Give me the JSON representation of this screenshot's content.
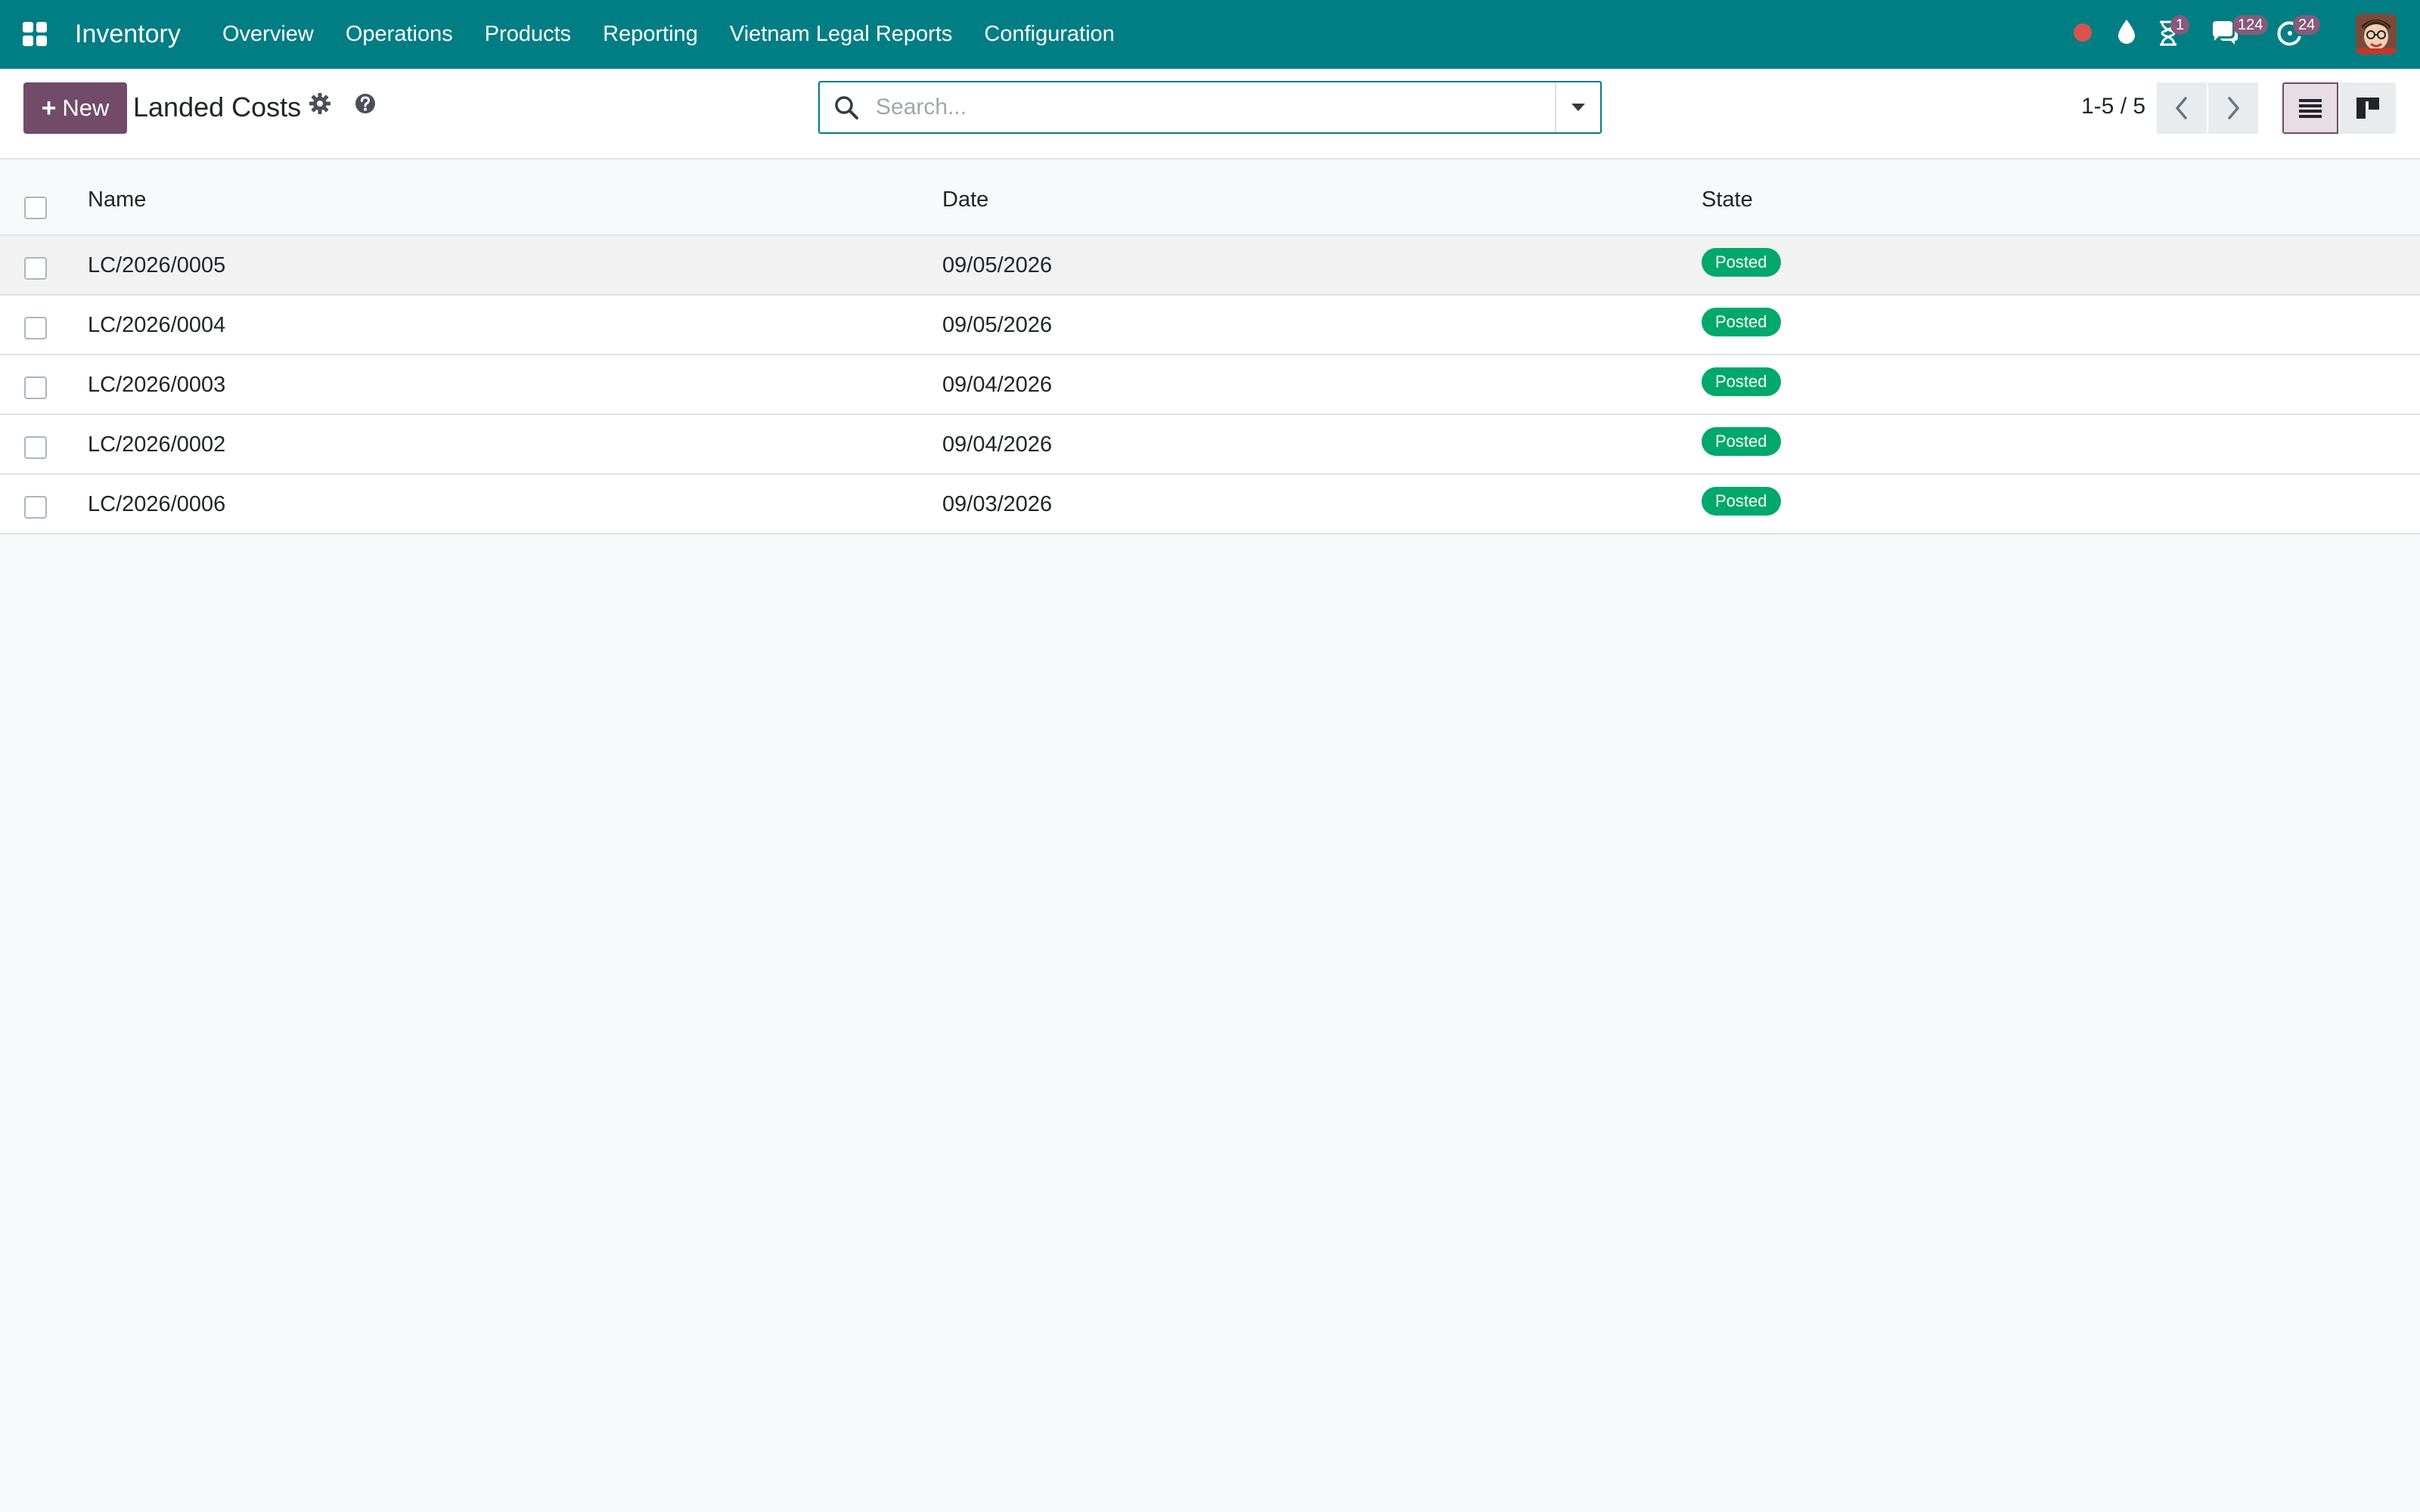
{
  "navbar": {
    "brand": "Inventory",
    "menu": [
      "Overview",
      "Operations",
      "Products",
      "Reporting",
      "Vietnam Legal Reports",
      "Configuration"
    ],
    "systray": {
      "activities_count": "1",
      "messages_count": "124",
      "updates_count": "24"
    },
    "color": "#017e84"
  },
  "control_panel": {
    "new_label": "New",
    "title": "Landed Costs",
    "search_placeholder": "Search...",
    "pager": "1-5 / 5",
    "accent": "#714b67"
  },
  "table": {
    "headers": {
      "name": "Name",
      "date": "Date",
      "state": "State"
    },
    "rows": [
      {
        "name": "LC/2026/0005",
        "date": "09/05/2026",
        "state": "Posted"
      },
      {
        "name": "LC/2026/0004",
        "date": "09/05/2026",
        "state": "Posted"
      },
      {
        "name": "LC/2026/0003",
        "date": "09/04/2026",
        "state": "Posted"
      },
      {
        "name": "LC/2026/0002",
        "date": "09/04/2026",
        "state": "Posted"
      },
      {
        "name": "LC/2026/0006",
        "date": "09/03/2026",
        "state": "Posted"
      }
    ],
    "status_color": "#00a86b"
  }
}
